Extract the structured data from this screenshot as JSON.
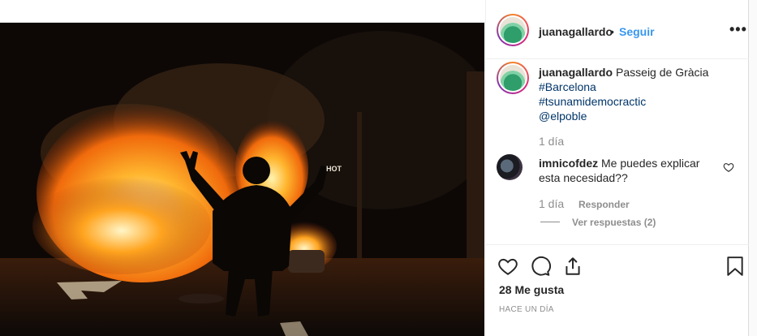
{
  "post": {
    "username": "juanagallardo",
    "separator": "•",
    "follow_label": "Seguir",
    "more_icon_label": "•••",
    "caption": {
      "username": "juanagallardo",
      "location": "Passeig de Gràcia",
      "tags": [
        "#Barcelona",
        "#tsunamidemocractic",
        "@elpoble"
      ],
      "time": "1 día"
    },
    "comments": [
      {
        "username": "imnicofdez",
        "text": "Me puedes explicar esta necesidad??",
        "time": "1 día",
        "reply_label": "Responder",
        "view_replies_label": "Ver respuestas (2)"
      }
    ],
    "likes_text": "28 Me gusta",
    "posted_ago": "HACE UN DÍA",
    "photo_sign_text": "HOT"
  },
  "icons": [
    "heart-icon",
    "comment-icon",
    "share-icon",
    "bookmark-icon",
    "more-options-icon",
    "small-heart-icon"
  ],
  "colors": {
    "accent": "#3897f0",
    "hashtag": "#003569",
    "muted": "#8e8e8e",
    "text": "#262626"
  }
}
